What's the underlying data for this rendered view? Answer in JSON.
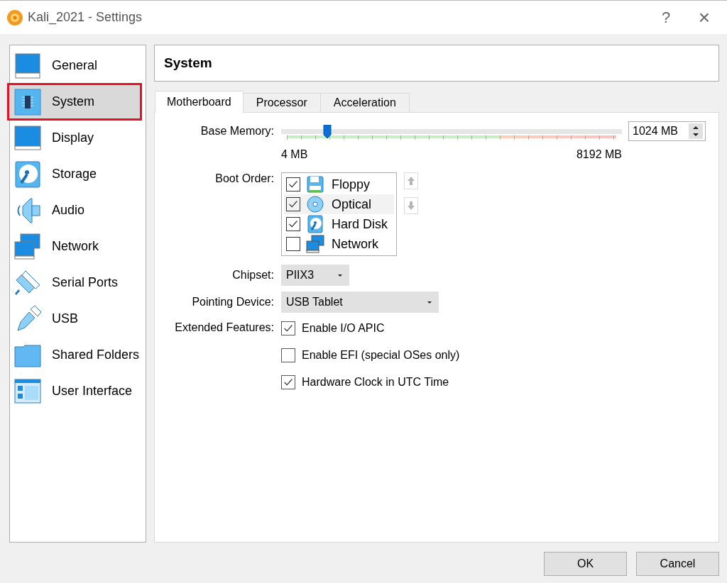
{
  "window": {
    "title": "Kali_2021 - Settings",
    "help": "?",
    "close": "×"
  },
  "sidebar": {
    "items": [
      {
        "label": "General",
        "selected": false
      },
      {
        "label": "System",
        "selected": true
      },
      {
        "label": "Display",
        "selected": false
      },
      {
        "label": "Storage",
        "selected": false
      },
      {
        "label": "Audio",
        "selected": false
      },
      {
        "label": "Network",
        "selected": false
      },
      {
        "label": "Serial Ports",
        "selected": false
      },
      {
        "label": "USB",
        "selected": false
      },
      {
        "label": "Shared Folders",
        "selected": false
      },
      {
        "label": "User Interface",
        "selected": false
      }
    ]
  },
  "page_title": "System",
  "tabs": [
    {
      "label": "Motherboard",
      "selected": true
    },
    {
      "label": "Processor",
      "selected": false
    },
    {
      "label": "Acceleration",
      "selected": false
    }
  ],
  "base_memory": {
    "label": "Base Memory:",
    "level": 0.135,
    "min_label": "4 MB",
    "max_label": "8192 MB",
    "value": "1024 MB"
  },
  "boot_order": {
    "label": "Boot Order:",
    "items": [
      {
        "label": "Floppy",
        "checked": true,
        "selected": false
      },
      {
        "label": "Optical",
        "checked": true,
        "selected": true
      },
      {
        "label": "Hard Disk",
        "checked": true,
        "selected": false
      },
      {
        "label": "Network",
        "checked": false,
        "selected": false
      }
    ]
  },
  "chipset": {
    "label": "Chipset:",
    "value": "PIIX3"
  },
  "pointing_device": {
    "label": "Pointing Device:",
    "value": "USB Tablet"
  },
  "extended_features": {
    "label": "Extended Features:",
    "options": [
      {
        "label": "Enable I/O APIC",
        "checked": true
      },
      {
        "label": "Enable EFI (special OSes only)",
        "checked": false
      },
      {
        "label": "Hardware Clock in UTC Time",
        "checked": true
      }
    ]
  },
  "buttons": [
    {
      "label": "OK"
    },
    {
      "label": "Cancel"
    }
  ]
}
